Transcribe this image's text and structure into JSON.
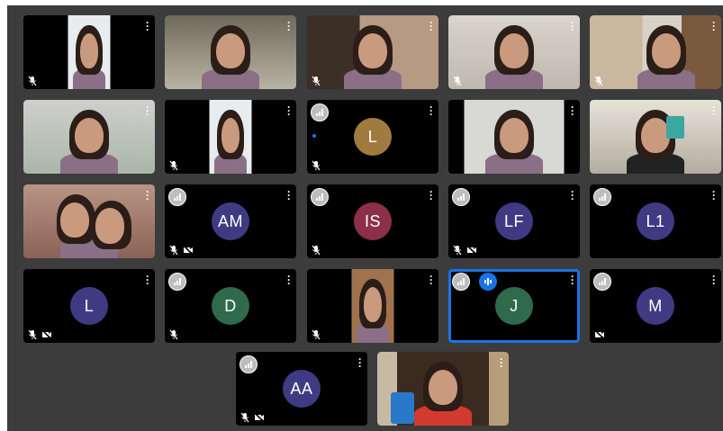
{
  "colors": {
    "grid_background": "#3c3c3c",
    "tile_background": "#000000",
    "active_border": "#1a73e8",
    "speaking_badge": "#1a73e8"
  },
  "menu_glyph": "⋮",
  "tiles": [
    {
      "id": "r1c1",
      "type": "video",
      "mic_muted": true,
      "cam_off": false,
      "scene": "woman-narrow"
    },
    {
      "id": "r1c2",
      "type": "video",
      "mic_muted": false,
      "cam_off": false,
      "scene": "woman-wave"
    },
    {
      "id": "r1c3",
      "type": "video",
      "mic_muted": true,
      "cam_off": false,
      "scene": "woman-room"
    },
    {
      "id": "r1c4",
      "type": "video",
      "mic_muted": true,
      "cam_off": false,
      "scene": "woman-curly"
    },
    {
      "id": "r1c5",
      "type": "video",
      "mic_muted": true,
      "cam_off": false,
      "scene": "woman-bookshelf"
    },
    {
      "id": "r2c1",
      "type": "video",
      "mic_muted": false,
      "cam_off": false,
      "scene": "woman-glasses"
    },
    {
      "id": "r2c2",
      "type": "video",
      "mic_muted": true,
      "cam_off": false,
      "scene": "woman-narrow"
    },
    {
      "id": "r2c3",
      "type": "avatar",
      "initials": "L",
      "color": "#a07b3f",
      "mic_muted": true,
      "cam_off": false,
      "signal": true
    },
    {
      "id": "r2c4",
      "type": "video",
      "mic_muted": false,
      "cam_off": false,
      "scene": "woman-wall"
    },
    {
      "id": "r2c5",
      "type": "video",
      "mic_muted": false,
      "cam_off": false,
      "scene": "woman-mug"
    },
    {
      "id": "r3c1",
      "type": "video",
      "mic_muted": false,
      "cam_off": false,
      "scene": "two-women"
    },
    {
      "id": "r3c2",
      "type": "avatar",
      "initials": "AM",
      "color": "#3f3b83",
      "mic_muted": true,
      "cam_off": true,
      "signal": true
    },
    {
      "id": "r3c3",
      "type": "avatar",
      "initials": "IS",
      "color": "#8c2f48",
      "mic_muted": true,
      "cam_off": false,
      "signal": true
    },
    {
      "id": "r3c4",
      "type": "avatar",
      "initials": "LF",
      "color": "#3f3b83",
      "mic_muted": true,
      "cam_off": true,
      "signal": true
    },
    {
      "id": "r3c5",
      "type": "avatar",
      "initials": "L1",
      "color": "#3f3b83",
      "mic_muted": false,
      "cam_off": false,
      "signal": true
    },
    {
      "id": "r4c1",
      "type": "avatar",
      "initials": "L",
      "color": "#3f3b83",
      "mic_muted": true,
      "cam_off": true,
      "signal": false
    },
    {
      "id": "r4c2",
      "type": "avatar",
      "initials": "D",
      "color": "#2f6b4a",
      "mic_muted": true,
      "cam_off": false,
      "signal": true
    },
    {
      "id": "r4c3",
      "type": "video",
      "mic_muted": true,
      "cam_off": false,
      "scene": "woman-narrow-glasses"
    },
    {
      "id": "r4c4",
      "type": "avatar",
      "initials": "J",
      "color": "#2f6b4a",
      "mic_muted": false,
      "cam_off": false,
      "signal": true,
      "speaking": true,
      "active": true
    },
    {
      "id": "r4c5",
      "type": "avatar",
      "initials": "M",
      "color": "#3f3b83",
      "mic_muted": false,
      "cam_off": true,
      "signal": true
    },
    {
      "id": "r5c1",
      "type": "avatar",
      "initials": "AA",
      "color": "#3f3b83",
      "mic_muted": true,
      "cam_off": true,
      "signal": true
    },
    {
      "id": "r5c2",
      "type": "video",
      "mic_muted": false,
      "cam_off": false,
      "scene": "woman-can"
    }
  ]
}
